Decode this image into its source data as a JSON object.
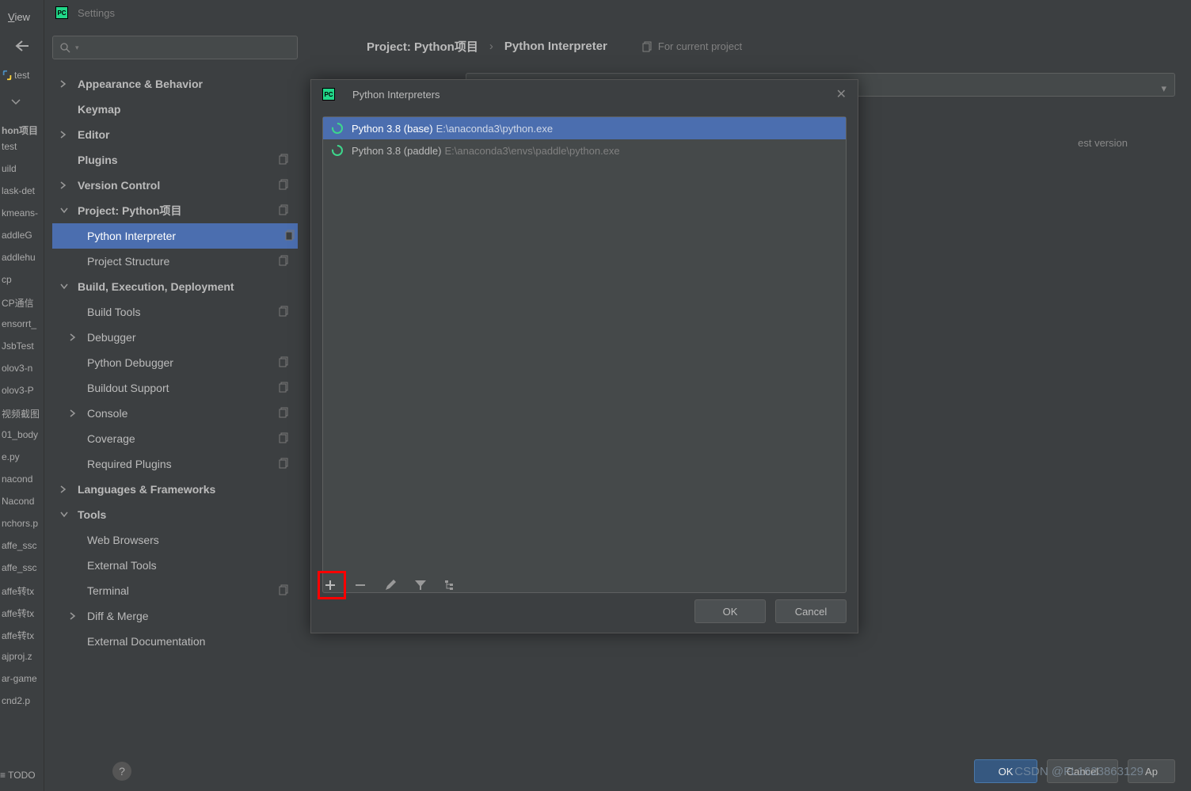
{
  "menu": {
    "view": "View"
  },
  "settings": {
    "title": "Settings",
    "search_placeholder": ""
  },
  "project_tree": {
    "root": "hon项目",
    "items": [
      "test",
      "uild",
      "lask-det",
      "kmeans-",
      "addleG",
      "addlehu",
      "cp",
      "CP通信",
      "ensorrt_",
      "JsbTest",
      "olov3-n",
      "olov3-P",
      "视频截图",
      "01_body",
      "e.py",
      "nacond",
      "Nacond",
      "nchors.p",
      "affe_ssc",
      "affe_ssc",
      "affe转tx",
      "affe转tx",
      "affe转tx",
      "ajproj.z",
      "ar-game",
      "cnd2.p"
    ],
    "todo": "TODO"
  },
  "tree": [
    {
      "label": "Appearance & Behavior",
      "chevron": ">",
      "top": true
    },
    {
      "label": "Keymap",
      "top": true,
      "no_chevron": true
    },
    {
      "label": "Editor",
      "chevron": ">",
      "top": true
    },
    {
      "label": "Plugins",
      "top": true,
      "no_chevron": true,
      "badge": true
    },
    {
      "label": "Version Control",
      "chevron": ">",
      "top": true,
      "badge": true
    },
    {
      "label": "Project: Python项目",
      "chevron": "v",
      "top": true,
      "badge": true
    },
    {
      "label": "Python Interpreter",
      "sub": true,
      "selected": true,
      "badge": true
    },
    {
      "label": "Project Structure",
      "sub": true,
      "badge": true
    },
    {
      "label": "Build, Execution, Deployment",
      "chevron": "v",
      "top": true
    },
    {
      "label": "Build Tools",
      "sub": true,
      "badge": true
    },
    {
      "label": "Debugger",
      "sub": true,
      "chevron": ">"
    },
    {
      "label": "Python Debugger",
      "sub": true,
      "badge": true
    },
    {
      "label": "Buildout Support",
      "sub": true,
      "badge": true
    },
    {
      "label": "Console",
      "sub": true,
      "chevron": ">",
      "badge": true
    },
    {
      "label": "Coverage",
      "sub": true,
      "badge": true
    },
    {
      "label": "Required Plugins",
      "sub": true,
      "badge": true
    },
    {
      "label": "Languages & Frameworks",
      "chevron": ">",
      "top": true
    },
    {
      "label": "Tools",
      "chevron": "v",
      "top": true
    },
    {
      "label": "Web Browsers",
      "sub": true
    },
    {
      "label": "External Tools",
      "sub": true
    },
    {
      "label": "Terminal",
      "sub": true,
      "badge": true
    },
    {
      "label": "Diff & Merge",
      "sub": true,
      "chevron": ">"
    },
    {
      "label": "External Documentation",
      "sub": true
    }
  ],
  "breadcrumb": {
    "item1": "Project: Python项目",
    "item2": "Python Interpreter",
    "tag": "For current project"
  },
  "latest_version": "est version",
  "modal": {
    "title": "Python Interpreters",
    "interpreters": [
      {
        "name": "Python 3.8 (base)",
        "path": "E:\\anaconda3\\python.exe",
        "selected": true
      },
      {
        "name": "Python 3.8 (paddle)",
        "path": "E:\\anaconda3\\envs\\paddle\\python.exe",
        "selected": false
      }
    ],
    "ok": "OK",
    "cancel": "Cancel"
  },
  "bottom": {
    "ok": "OK",
    "cancel": "Cancel",
    "apply": "Ap"
  },
  "watermark": "CSDN @FL1623863129"
}
